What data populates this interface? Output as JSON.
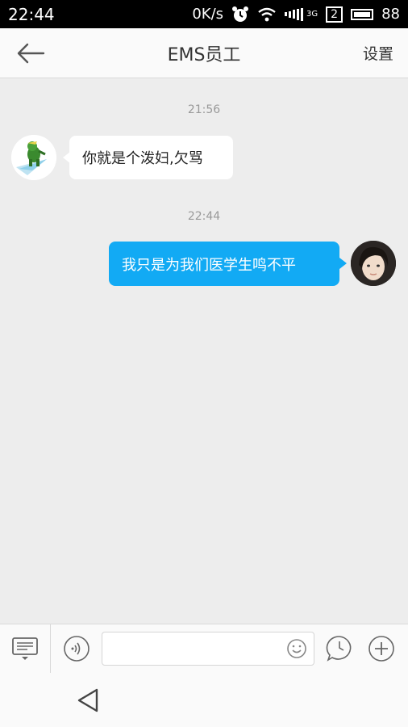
{
  "status_bar": {
    "time": "22:44",
    "speed": "0K/s",
    "network": "3G",
    "sim_slot": "2",
    "battery": "88"
  },
  "header": {
    "back_icon": "arrow-left-icon",
    "title": "EMS员工",
    "settings_label": "设置"
  },
  "messages": [
    {
      "timestamp": "21:56",
      "direction": "incoming",
      "text": "你就是个泼妇,欠骂",
      "avatar": "cartoon-green-character"
    },
    {
      "timestamp": "22:44",
      "direction": "outgoing",
      "text": "我只是为我们医学生鸣不平",
      "avatar": "user-photo"
    }
  ],
  "input_bar": {
    "keyboard_toggle_icon": "keyboard-menu-icon",
    "voice_icon": "voice-icon",
    "text_value": "",
    "emoji_icon": "emoji-icon",
    "clock_icon": "clock-bubble-icon",
    "add_icon": "plus-icon"
  },
  "system_nav": {
    "back_icon": "triangle-back-icon"
  },
  "colors": {
    "outgoing_bubble": "#12aaf4",
    "incoming_bubble": "#ffffff",
    "background": "#ededed"
  }
}
